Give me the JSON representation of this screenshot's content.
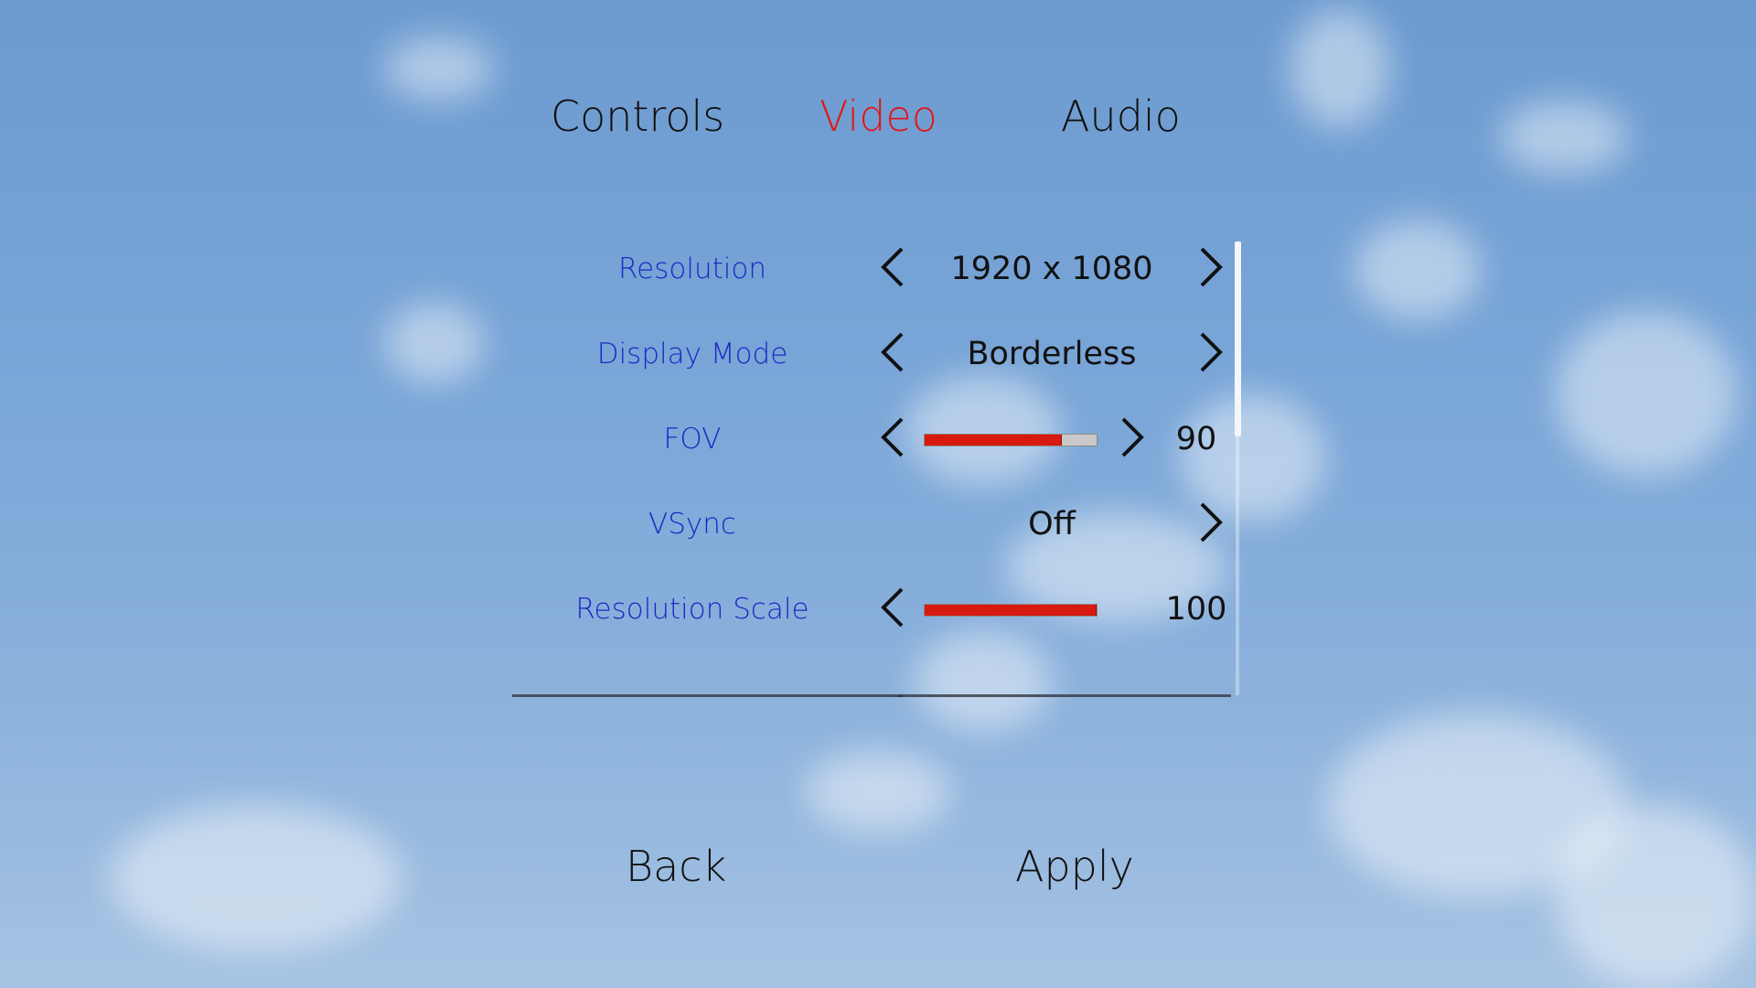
{
  "tabs": [
    {
      "label": "Controls",
      "active": false
    },
    {
      "label": "Video",
      "active": true
    },
    {
      "label": "Audio",
      "active": false
    }
  ],
  "colors": {
    "active_tab": "#e01818",
    "setting_label": "#1a2ac4",
    "slider_fill": "#d71a10",
    "slider_track": "#c9c9c9"
  },
  "settings": [
    {
      "label": "Resolution",
      "value": "1920 x 1080"
    },
    {
      "label": "Display Mode",
      "value": "Borderless"
    },
    {
      "label": "FOV",
      "value": "90",
      "slider_fraction": 0.8
    },
    {
      "label": "VSync",
      "value": "Off"
    },
    {
      "label": "Resolution Scale",
      "value": "100",
      "slider_fraction": 1.0
    }
  ],
  "icons": {
    "left": "chevron-left-icon",
    "right": "chevron-right-icon"
  },
  "scrollbar": {
    "visible_fraction": 0.43
  },
  "footer": {
    "back_label": "Back",
    "apply_label": "Apply"
  }
}
